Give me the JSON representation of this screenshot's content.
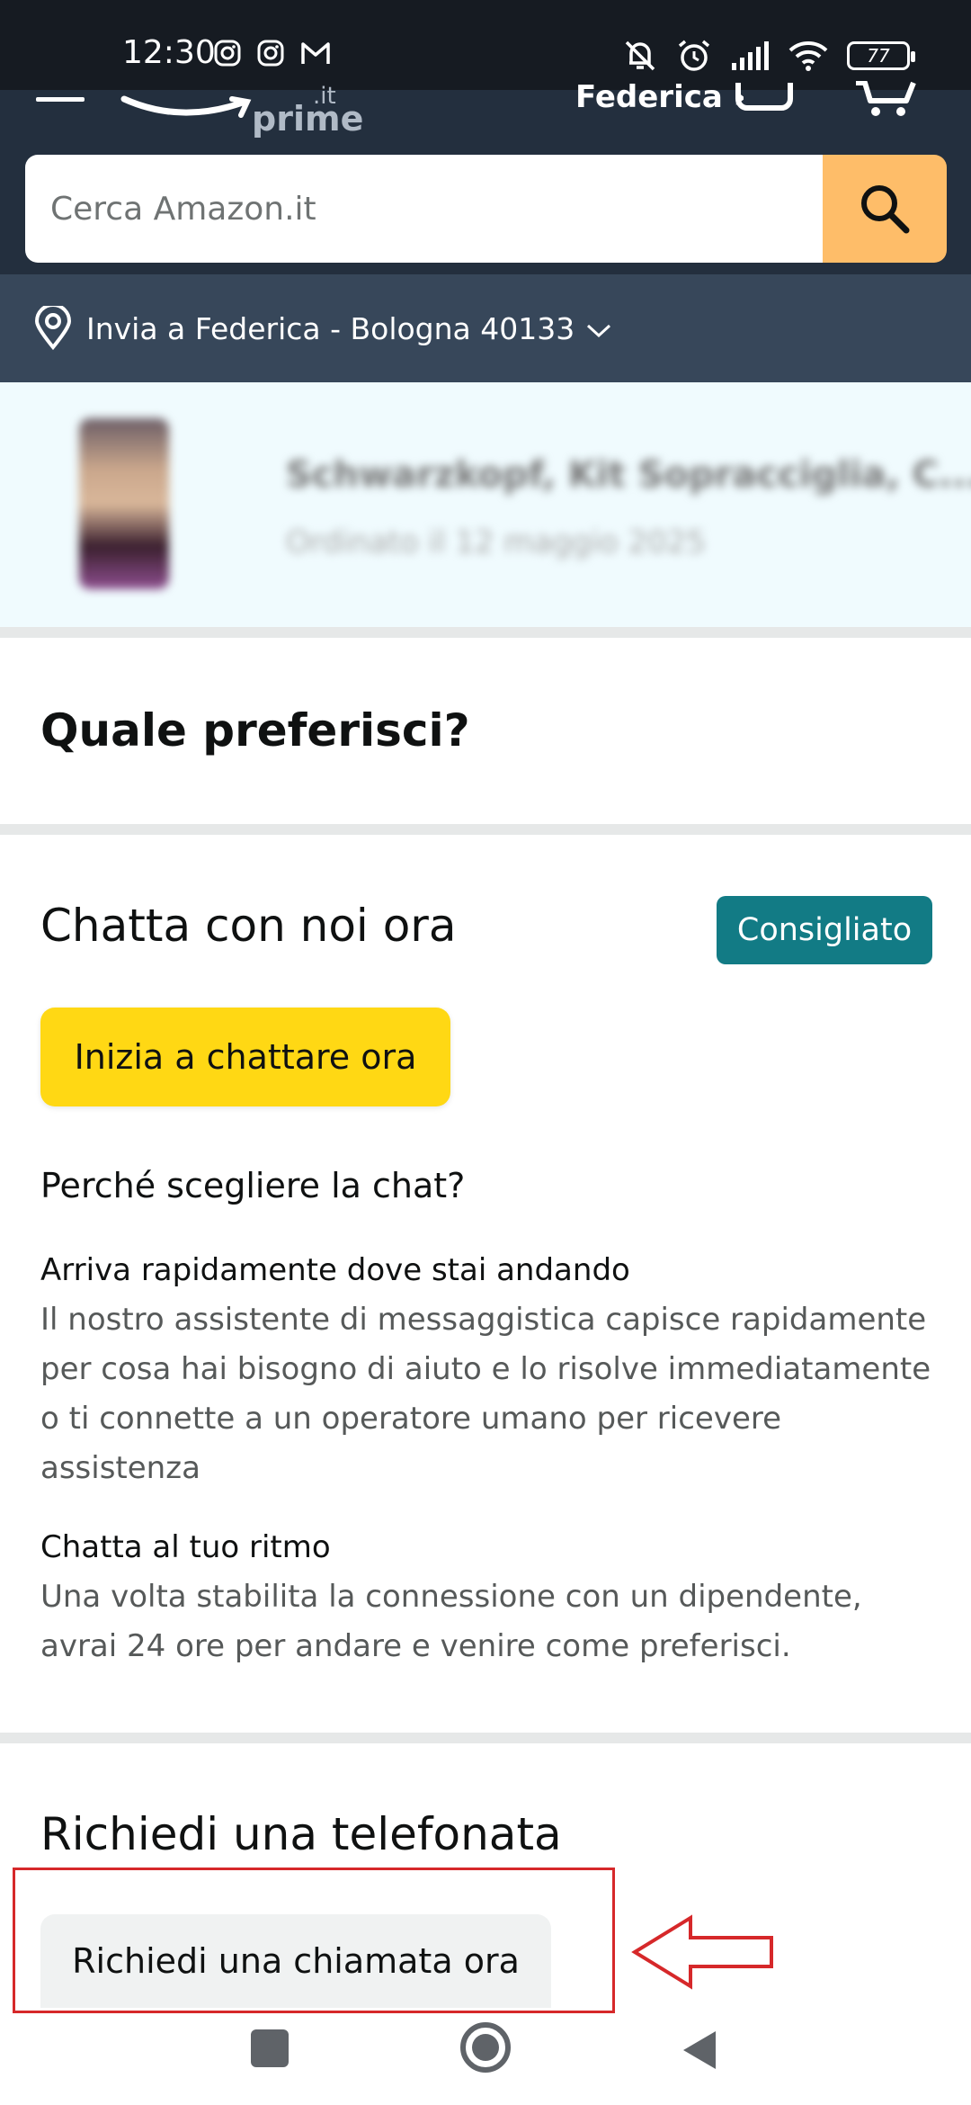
{
  "status_bar": {
    "time": "12:30",
    "battery": "77",
    "left_icons": [
      "instagram-icon",
      "instagram-icon",
      "gmail-icon"
    ],
    "right_icons": [
      "mute-icon",
      "alarm-icon",
      "signal-icon",
      "wifi-icon",
      "battery-icon"
    ]
  },
  "header": {
    "logo_prime": "prime",
    "logo_tld": ".it",
    "account_label": "Federica ›",
    "search": {
      "placeholder": "Cerca Amazon.it"
    },
    "deliver_to": "Invia a Federica - Bologna 40133"
  },
  "order": {
    "title": "Schwarzkopf, Kit Sopracciglia, C...",
    "date": "Ordinato il 12 maggio 2025"
  },
  "main": {
    "section_title": "Quale preferisci?",
    "chat": {
      "title": "Chatta con noi ora",
      "badge": "Consigliato",
      "button": "Inizia a chattare ora",
      "why_title": "Perché scegliere la chat?",
      "reasons": [
        {
          "title": "Arriva rapidamente dove stai andando",
          "body": "Il nostro assistente di messaggistica capisce rapidamente per cosa hai bisogno di aiuto e lo risolve immediatamente o ti connette a un operatore umano per ricevere assistenza"
        },
        {
          "title": "Chatta al tuo ritmo",
          "body": "Una volta stabilita la connessione con un dipendente, avrai 24 ore per andare e venire come preferisci."
        }
      ]
    },
    "phone": {
      "title": "Richiedi una telefonata",
      "button": "Richiedi una chiamata ora"
    }
  },
  "colors": {
    "header_bg": "#232f3e",
    "deliver_bg": "#37475a",
    "search_button": "#febd69",
    "chat_button": "#ffd814",
    "badge": "#127b85",
    "annotation": "#d6282a"
  }
}
